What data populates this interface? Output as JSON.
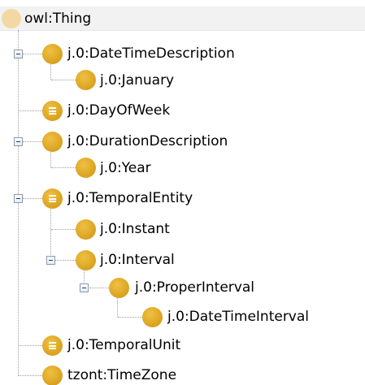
{
  "tree": {
    "root": {
      "label": "owl:Thing",
      "icon": "owl-thing-icon"
    },
    "nodes": [
      {
        "id": "datetime-description",
        "label": "j.0:DateTimeDescription",
        "icon": "class-icon",
        "expanded": true
      },
      {
        "id": "january",
        "label": "j.0:January",
        "icon": "class-icon"
      },
      {
        "id": "day-of-week",
        "label": "j.0:DayOfWeek",
        "icon": "defined-class-icon"
      },
      {
        "id": "duration-description",
        "label": "j.0:DurationDescription",
        "icon": "class-icon",
        "expanded": true
      },
      {
        "id": "year",
        "label": "j.0:Year",
        "icon": "class-icon"
      },
      {
        "id": "temporal-entity",
        "label": "j.0:TemporalEntity",
        "icon": "defined-class-icon",
        "expanded": true
      },
      {
        "id": "instant",
        "label": "j.0:Instant",
        "icon": "class-icon"
      },
      {
        "id": "interval",
        "label": "j.0:Interval",
        "icon": "class-icon",
        "expanded": true
      },
      {
        "id": "proper-interval",
        "label": "j.0:ProperInterval",
        "icon": "class-icon",
        "expanded": true
      },
      {
        "id": "datetime-interval",
        "label": "j.0:DateTimeInterval",
        "icon": "class-icon"
      },
      {
        "id": "temporal-unit",
        "label": "j.0:TemporalUnit",
        "icon": "defined-class-icon"
      },
      {
        "id": "time-zone",
        "label": "tzont:TimeZone",
        "icon": "class-icon"
      }
    ]
  },
  "colors": {
    "class_icon": "#dca623",
    "root_icon": "#f2d9a4",
    "root_row_bg": "#f2f2f2",
    "connector": "#a0a0a0"
  }
}
